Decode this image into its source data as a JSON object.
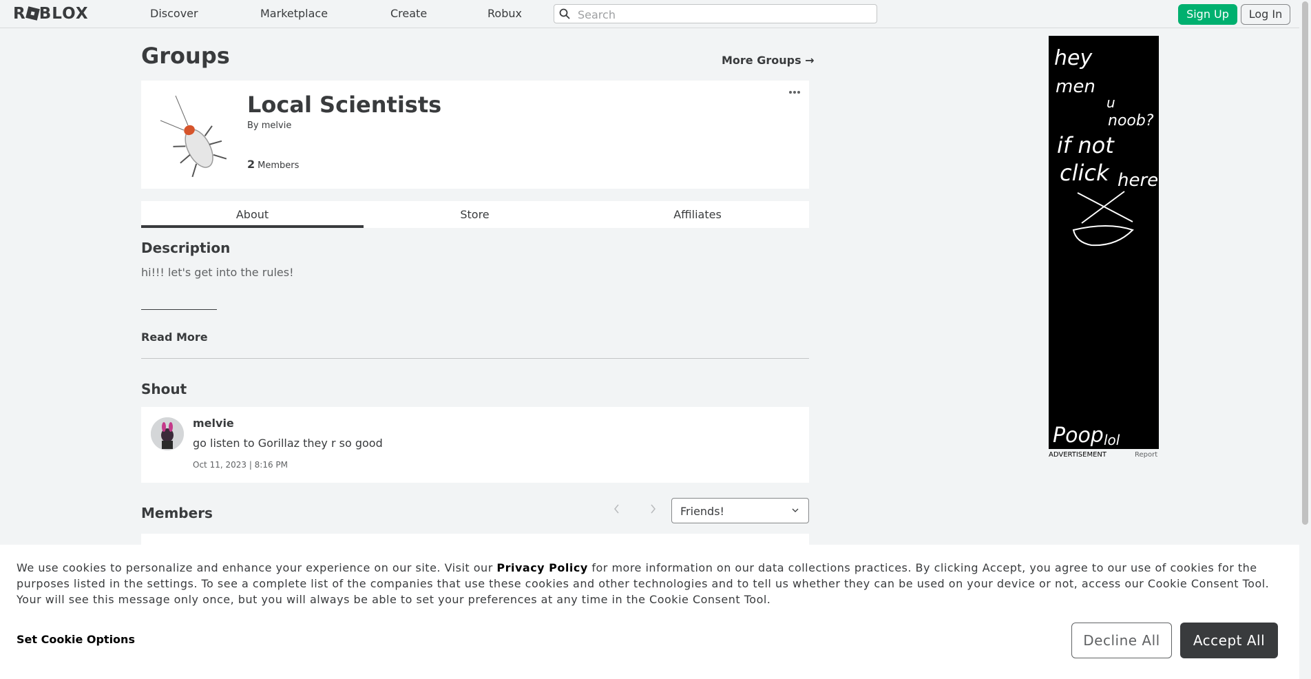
{
  "nav": {
    "logo": "ROBLOX",
    "links": [
      "Discover",
      "Marketplace",
      "Create",
      "Robux"
    ],
    "search_placeholder": "Search",
    "signup": "Sign Up",
    "login": "Log In"
  },
  "page": {
    "title": "Groups",
    "more_groups": "More Groups →"
  },
  "group": {
    "name": "Local Scientists",
    "by_prefix": "By",
    "owner": "melvie",
    "member_count": "2",
    "members_label": "Members"
  },
  "tabs": [
    "About",
    "Store",
    "Affiliates"
  ],
  "about": {
    "description_title": "Description",
    "description_text": "hi!!! let's get into the rules!",
    "read_more": "Read More"
  },
  "shout": {
    "title": "Shout",
    "author": "melvie",
    "message": "go listen to Gorillaz they r so good",
    "date": "Oct 11, 2023 | 8:16 PM"
  },
  "members": {
    "title": "Members",
    "filter": "Friends!"
  },
  "ad": {
    "lines": [
      "hey",
      "men",
      "u",
      "noob?",
      "if not",
      "click",
      "here",
      "Poop",
      "lol"
    ],
    "label": "ADVERTISEMENT",
    "report": "Report"
  },
  "cookie": {
    "text_before": "We use cookies to personalize and enhance your experience on our site. Visit our ",
    "privacy_link": "Privacy Policy",
    "text_after": " for more information on our data collections practices. By clicking Accept, you agree to our use of cookies for the purposes listed in the settings. To see a complete list of the companies that use these cookies and other technologies and to tell us whether they can be used on your device or not, access our Cookie Consent Tool. Your will see this message only once, but you will always be able to set your preferences at any time in the Cookie Consent Tool.",
    "set_options": "Set Cookie Options",
    "decline": "Decline All",
    "accept": "Accept All"
  },
  "colors": {
    "background": "#f2f4f5",
    "signup_green": "#00b06f",
    "text_dark": "#393b3d"
  }
}
